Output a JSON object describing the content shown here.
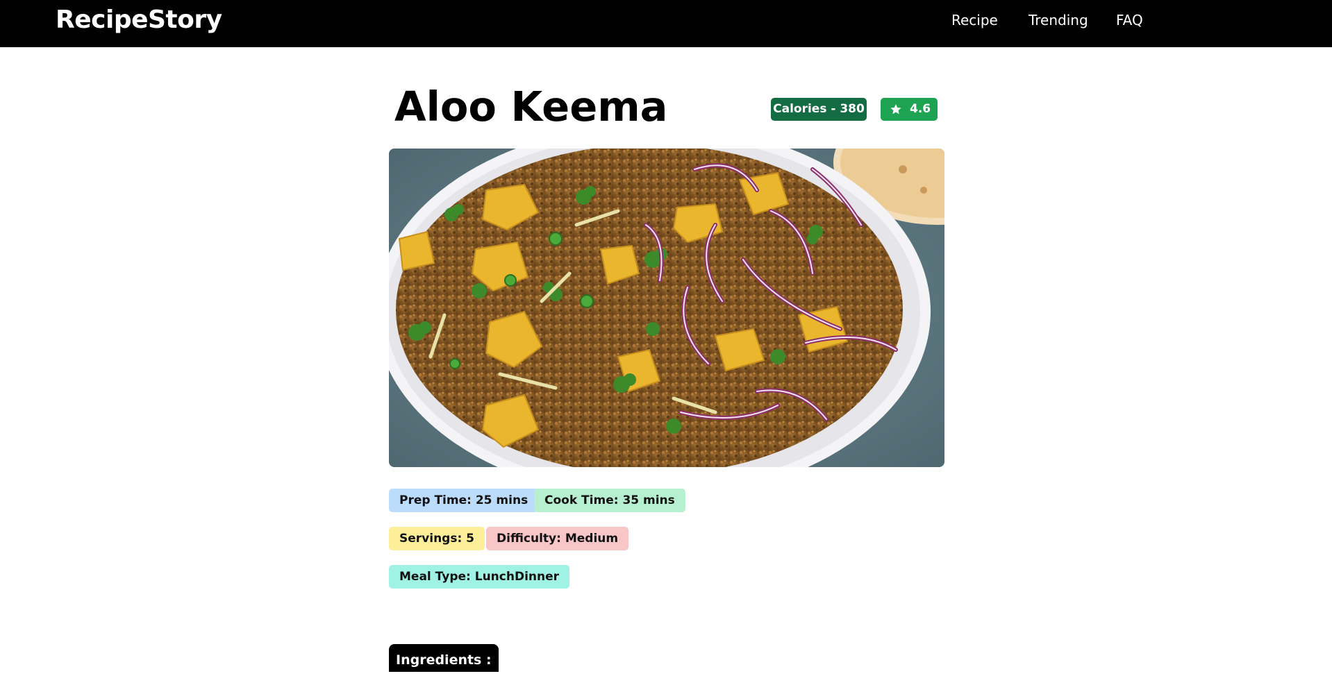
{
  "nav": {
    "brand": "RecipeStory",
    "links": [
      "Recipe",
      "Trending",
      "FAQ"
    ]
  },
  "recipe": {
    "title": "Aloo Keema",
    "calories_label": "Calories - 380",
    "rating": "4.6",
    "prep_time": "Prep Time: 25 mins",
    "cook_time": "Cook Time: 35 mins",
    "servings": "Servings: 5",
    "difficulty": "Difficulty: Medium",
    "meal_type": "Meal Type: LunchDinner"
  },
  "sections": {
    "ingredients_label": "Ingredients :"
  },
  "icons": {
    "rating": "star-icon"
  },
  "colors": {
    "nav_bg": "#000000",
    "calories_badge": "#146c43",
    "rating_badge": "#1ea352",
    "prep_chip": "#bcdcfb",
    "cook_chip": "#b7efd1",
    "servings_chip": "#fdee99",
    "difficulty_chip": "#f9c6c8",
    "meal_chip": "#9ff2e4"
  }
}
